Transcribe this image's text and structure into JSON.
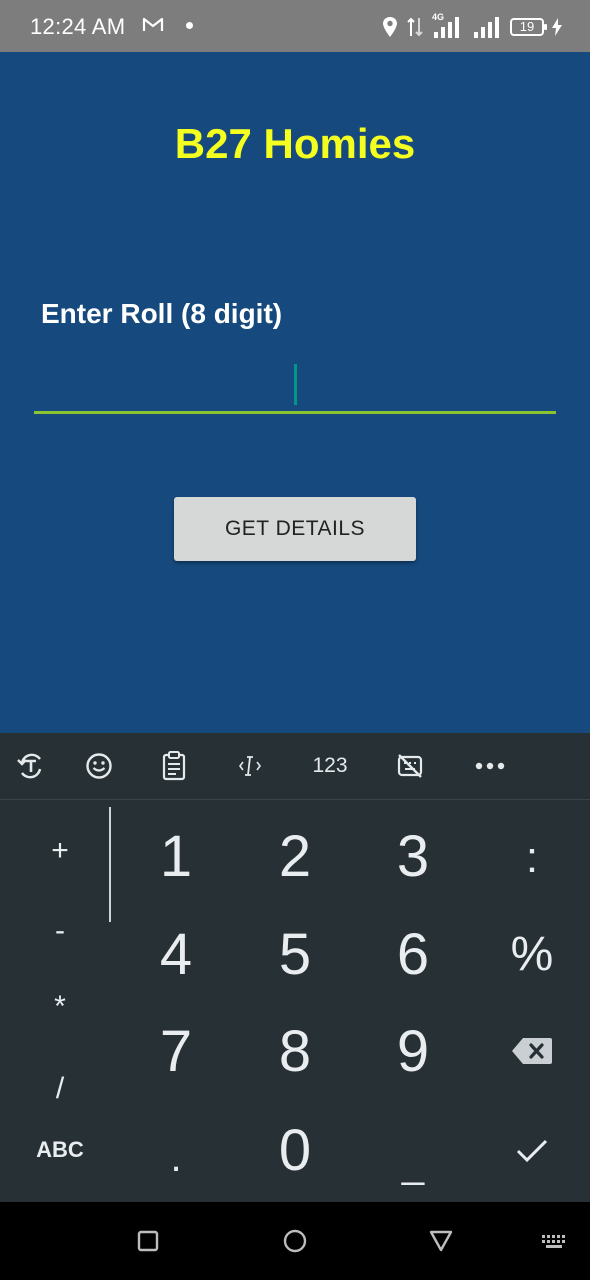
{
  "status_bar": {
    "time": "12:24 AM",
    "network": "4G",
    "battery": "19"
  },
  "app": {
    "title": "B27 Homies",
    "roll_label": "Enter Roll (8 digit)",
    "roll_value": "",
    "button_label": "GET DETAILS",
    "colors": {
      "background": "#16497d",
      "title": "#f5ff1f",
      "underline": "#8ac531"
    }
  },
  "keyboard": {
    "toolbar": {
      "icons": [
        "translate-icon",
        "emoji-icon",
        "clipboard-icon",
        "cursor-icon",
        "numbers-text",
        "hide-keyboard-icon",
        "more-icon"
      ],
      "numbers_label": "123"
    },
    "left_symbols": [
      "+",
      "-",
      "*",
      "/"
    ],
    "digits": [
      "1",
      "2",
      "3",
      "4",
      "5",
      "6",
      "7",
      "8",
      "9",
      "0"
    ],
    "right_symbols": [
      ":",
      "%"
    ],
    "abc_label": "ABC",
    "dot": ".",
    "space": "_",
    "icons": {
      "backspace": "backspace-icon",
      "enter": "check-icon"
    }
  },
  "nav_bar": {
    "icons": [
      "recent-apps-icon",
      "home-icon",
      "back-icon",
      "keyboard-switch-icon"
    ]
  }
}
